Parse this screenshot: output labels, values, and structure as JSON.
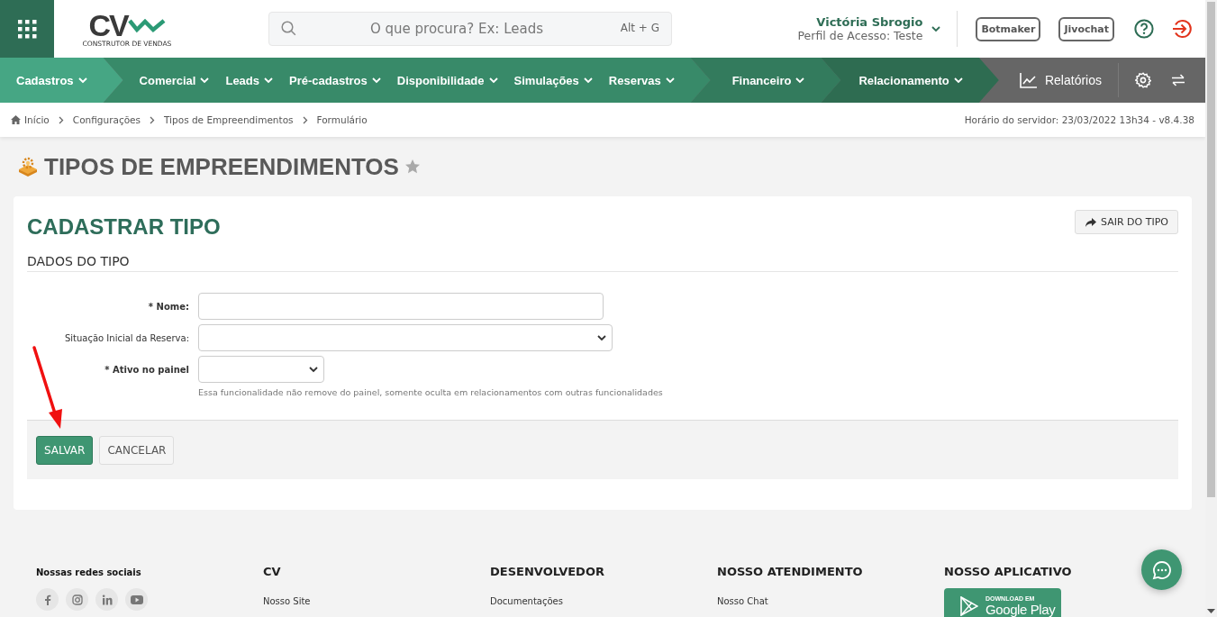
{
  "header": {
    "logo": {
      "text": "CV",
      "tagline": "CONSTRUTOR DE VENDAS"
    },
    "search": {
      "placeholder": "O que procura? Ex: Leads",
      "shortcut": "Alt + G"
    },
    "user": {
      "name": "Victória Sbrogio",
      "profile": "Perfil de Acesso: Teste"
    },
    "buttons": [
      "Botmaker",
      "Jivochat"
    ]
  },
  "nav": {
    "groups": [
      {
        "selected": true,
        "items": [
          "Cadastros"
        ]
      },
      {
        "selected": false,
        "items": [
          "Comercial",
          "Leads",
          "Pré-cadastros",
          "Disponibilidade",
          "Simulações",
          "Reservas"
        ]
      },
      {
        "selected": false,
        "items": [
          "Financeiro"
        ]
      },
      {
        "selected": false,
        "items": [
          "Relacionamento"
        ]
      }
    ],
    "reports": "Relatórios"
  },
  "breadcrumb": [
    "Início",
    "Configurações",
    "Tipos de Empreendimentos",
    "Formulário"
  ],
  "server_time": "Horário do servidor: 23/03/2022 13h34 - v8.4.38",
  "page_title": "TIPOS DE EMPREENDIMENTOS",
  "favorite": false,
  "form": {
    "title": "CADASTRAR TIPO",
    "exit_button": "SAIR DO TIPO",
    "section": "DADOS DO TIPO",
    "fields": [
      {
        "kind": "text",
        "label": "* Nome:",
        "required": true
      },
      {
        "kind": "select",
        "label": "Situação Inicial da Reserva:",
        "required": false
      },
      {
        "kind": "select-small",
        "label": "* Ativo no painel",
        "required": true,
        "hint": "Essa funcionalidade não remove do painel, somente oculta em relacionamentos com outras funcionalidades"
      }
    ],
    "buttons": [
      {
        "label": "SALVAR",
        "primary": true
      },
      {
        "label": "CANCELAR",
        "primary": false
      }
    ]
  },
  "footer": {
    "columns": [
      {
        "kind": "social",
        "title": "Nossas redes sociais"
      },
      {
        "kind": "links",
        "title": "CV",
        "links": [
          "Nosso Site"
        ]
      },
      {
        "kind": "links",
        "title": "DESENVOLVEDOR",
        "links": [
          "Documentações"
        ]
      },
      {
        "kind": "links",
        "title": "NOSSO ATENDIMENTO",
        "links": [
          "Nosso Chat"
        ]
      },
      {
        "kind": "app",
        "title": "NOSSO APLICATIVO",
        "badge": {
          "caption": "DOWNLOAD EM",
          "store": "Google Play"
        }
      }
    ]
  }
}
